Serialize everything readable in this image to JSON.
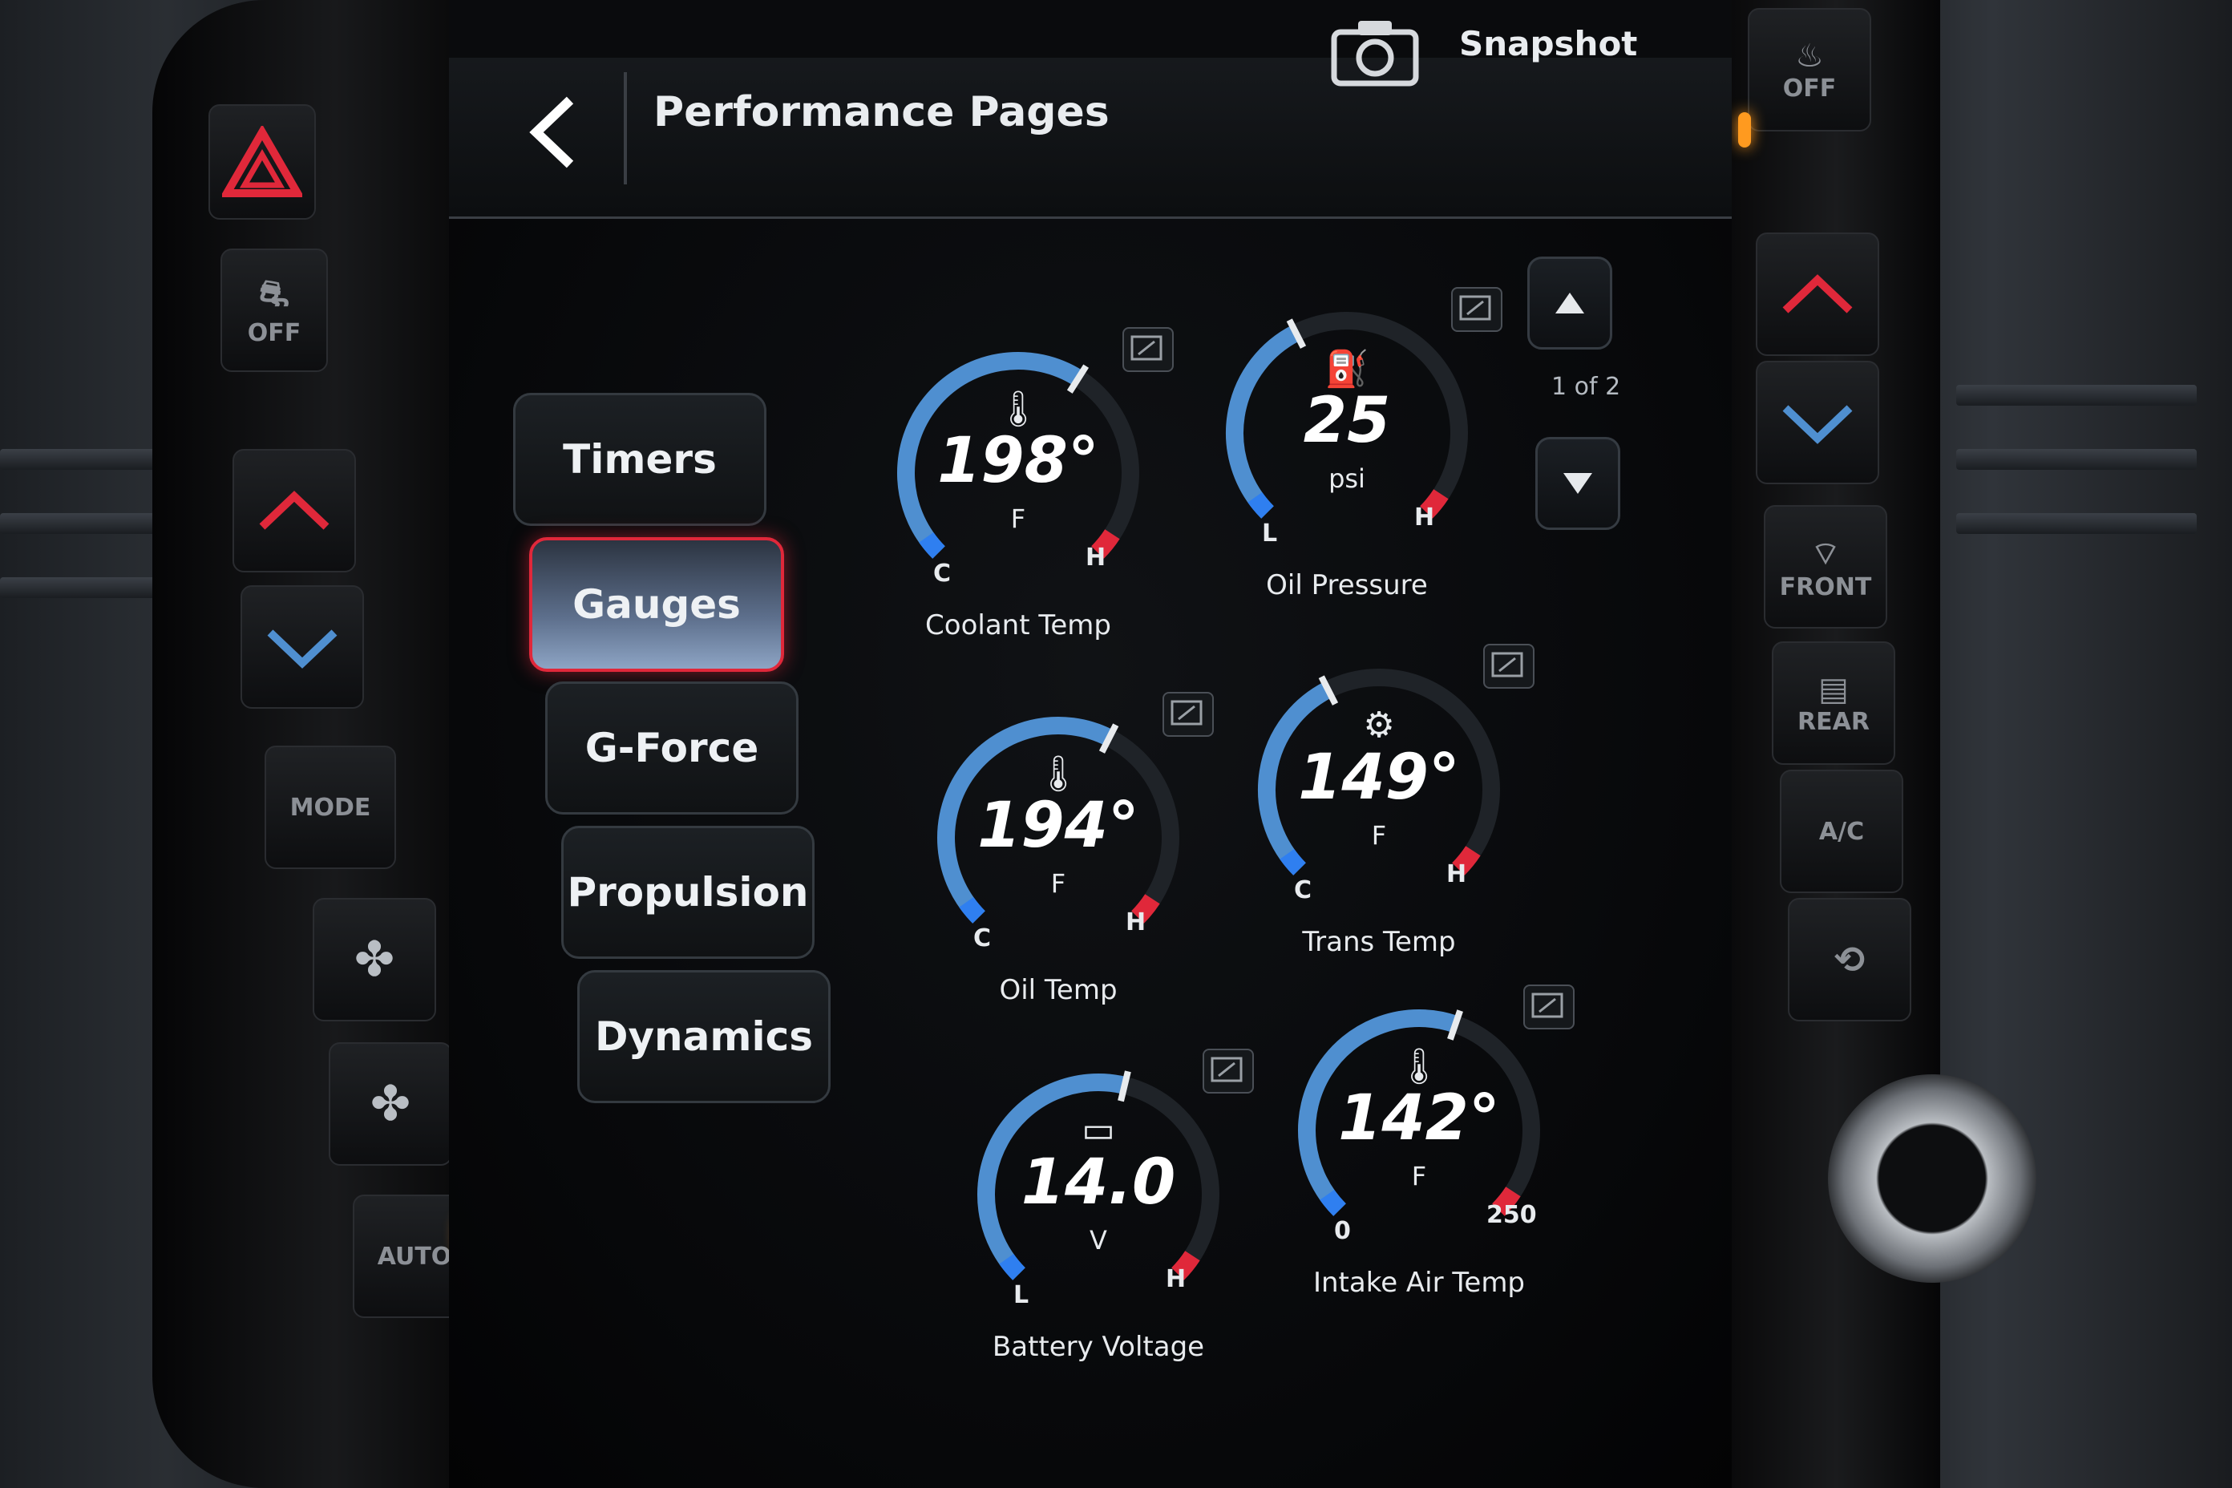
{
  "header": {
    "title": "Performance Pages",
    "snapshot_label": "Snapshot"
  },
  "tabs": [
    {
      "label": "Timers",
      "active": false
    },
    {
      "label": "Gauges",
      "active": true
    },
    {
      "label": "G-Force",
      "active": false
    },
    {
      "label": "Propulsion",
      "active": false
    },
    {
      "label": "Dynamics",
      "active": false
    }
  ],
  "pagination": {
    "indicator": "1 of 2"
  },
  "gauges": [
    {
      "id": "coolant",
      "label": "Coolant Temp",
      "value": "198°",
      "unit": "F",
      "low": "C",
      "high": "H",
      "icon": "thermometer-liquid-icon",
      "level": 0.62
    },
    {
      "id": "oilpress",
      "label": "Oil Pressure",
      "value": "25",
      "unit": "psi",
      "low": "L",
      "high": "H",
      "icon": "oil-can-icon",
      "level": 0.4
    },
    {
      "id": "oiltemp",
      "label": "Oil Temp",
      "value": "194°",
      "unit": "F",
      "low": "C",
      "high": "H",
      "icon": "oil-temp-icon",
      "level": 0.6
    },
    {
      "id": "trans",
      "label": "Trans Temp",
      "value": "149°",
      "unit": "F",
      "low": "C",
      "high": "H",
      "icon": "transmission-icon",
      "level": 0.4
    },
    {
      "id": "battery",
      "label": "Battery Voltage",
      "value": "14.0",
      "unit": "V",
      "low": "L",
      "high": "H",
      "icon": "battery-icon",
      "level": 0.55
    },
    {
      "id": "intake",
      "label": "Intake Air Temp",
      "value": "142°",
      "unit": "F",
      "low": "0",
      "high": "250",
      "icon": "intake-air-icon",
      "level": 0.57
    }
  ],
  "bezel_left": {
    "esc_label": "OFF",
    "mode_label": "MODE",
    "auto_label": "AUTO"
  },
  "bezel_right": {
    "top_label": "OFF",
    "front_label": "FRONT",
    "rear_label": "REAR",
    "ac_label": "A/C"
  },
  "colors": {
    "accent_blue": "#4f8fd0",
    "alert_red": "#e0283a",
    "led_amber": "#ff9a1f"
  }
}
